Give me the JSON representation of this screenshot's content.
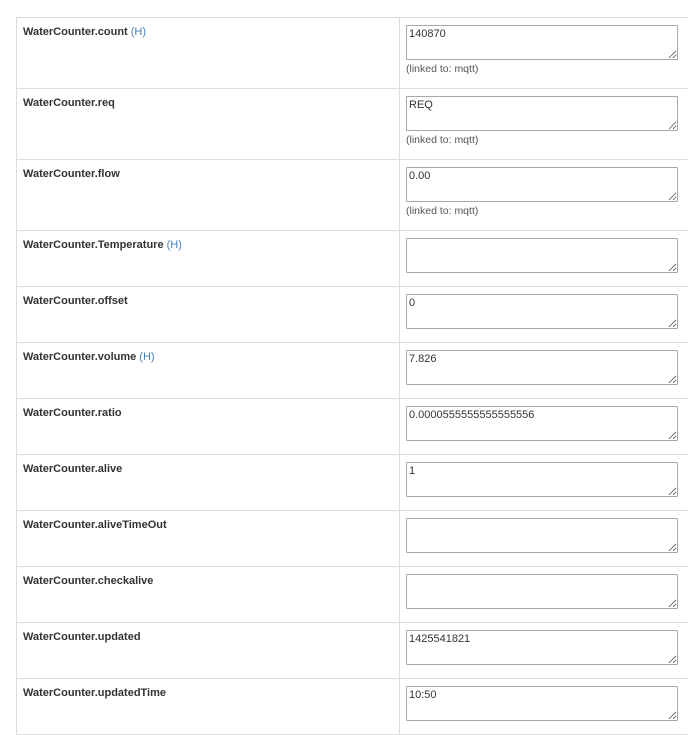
{
  "readings": [
    {
      "name": "WaterCounter.count",
      "history_label": "(H)",
      "value": "140870",
      "linked_note": "(linked to: mqtt)"
    },
    {
      "name": "WaterCounter.req",
      "history_label": "",
      "value": "REQ",
      "linked_note": "(linked to: mqtt)"
    },
    {
      "name": "WaterCounter.flow",
      "history_label": "",
      "value": "0.00",
      "linked_note": "(linked to: mqtt)"
    },
    {
      "name": "WaterCounter.Temperature",
      "history_label": "(H)",
      "value": "",
      "linked_note": ""
    },
    {
      "name": "WaterCounter.offset",
      "history_label": "",
      "value": "0",
      "linked_note": ""
    },
    {
      "name": "WaterCounter.volume",
      "history_label": "(H)",
      "value": "7.826",
      "linked_note": ""
    },
    {
      "name": "WaterCounter.ratio",
      "history_label": "",
      "value": "0.0000555555555555556",
      "linked_note": ""
    },
    {
      "name": "WaterCounter.alive",
      "history_label": "",
      "value": "1",
      "linked_note": ""
    },
    {
      "name": "WaterCounter.aliveTimeOut",
      "history_label": "",
      "value": "",
      "linked_note": ""
    },
    {
      "name": "WaterCounter.checkalive",
      "history_label": "",
      "value": "",
      "linked_note": ""
    },
    {
      "name": "WaterCounter.updated",
      "history_label": "",
      "value": "1425541821",
      "linked_note": ""
    },
    {
      "name": "WaterCounter.updatedTime",
      "history_label": "",
      "value": "10:50",
      "linked_note": ""
    }
  ],
  "colors": {
    "history_link": "#4a7fb5",
    "border": "#dddddd"
  }
}
